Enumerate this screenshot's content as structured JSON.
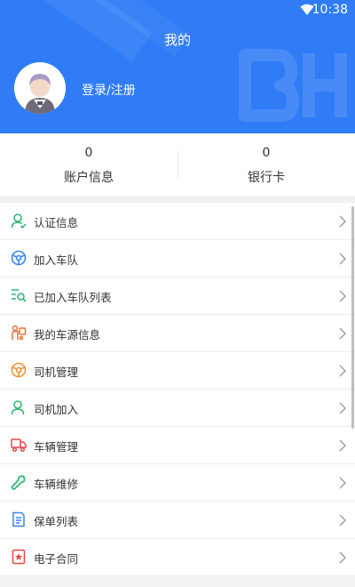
{
  "status_bar": {
    "time": "10:38"
  },
  "header": {
    "title": "我的",
    "login_text": "登录/注册"
  },
  "stats": [
    {
      "value": "0",
      "label": "账户信息"
    },
    {
      "value": "0",
      "label": "银行卡"
    }
  ],
  "menu": [
    {
      "label": "认证信息",
      "icon": "person-check-icon",
      "color": "#2eb872"
    },
    {
      "label": "加入车队",
      "icon": "steering-wheel-icon",
      "color": "#3a86f0"
    },
    {
      "label": "已加入车队列表",
      "icon": "list-search-icon",
      "color": "#2eb872"
    },
    {
      "label": "我的车源信息",
      "icon": "truck-cargo-icon",
      "color": "#f06d3a"
    },
    {
      "label": "司机管理",
      "icon": "steering-wheel-icon",
      "color": "#f0913a"
    },
    {
      "label": "司机加入",
      "icon": "person-add-icon",
      "color": "#2eb872"
    },
    {
      "label": "车辆管理",
      "icon": "truck-icon",
      "color": "#e84545"
    },
    {
      "label": "车辆维修",
      "icon": "wrench-icon",
      "color": "#2eb872"
    },
    {
      "label": "保单列表",
      "icon": "document-icon",
      "color": "#3a86f0"
    },
    {
      "label": "电子合同",
      "icon": "contract-icon",
      "color": "#e84545"
    }
  ],
  "colors": {
    "brand": "#2f7cf6"
  }
}
